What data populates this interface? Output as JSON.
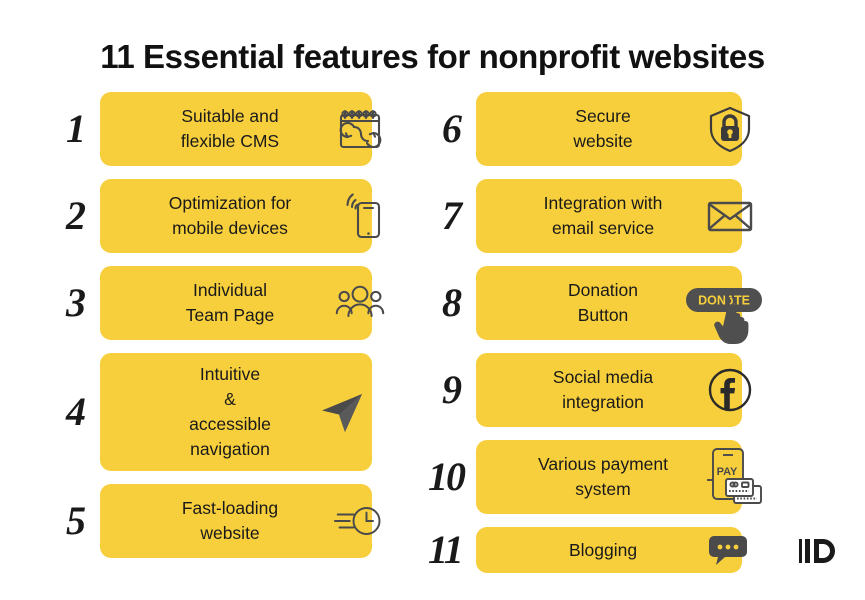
{
  "page": {
    "title": "11 Essential features for nonprofit websites",
    "background_color": "#FFFFFF",
    "accent_color": "#F7CF3C",
    "text_color": "#1A1A1A",
    "icon_color": "#4A4A4A"
  },
  "left_column": [
    {
      "number": "1",
      "label": "Suitable and\nflexible CMS",
      "icon": "cms-calendar-refresh-icon",
      "lines": 2
    },
    {
      "number": "2",
      "label": "Optimization for\nmobile devices",
      "icon": "mobile-signal-icon",
      "lines": 2
    },
    {
      "number": "3",
      "label": "Individual\nTeam Page",
      "icon": "people-group-icon",
      "lines": 2
    },
    {
      "number": "4",
      "label": "Intuitive\n&\naccessible\nnavigation",
      "icon": "navigation-arrow-icon",
      "lines": 4
    },
    {
      "number": "5",
      "label": "Fast-loading\nwebsite",
      "icon": "fast-clock-icon",
      "lines": 2
    }
  ],
  "right_column": [
    {
      "number": "6",
      "label": "Secure\nwebsite",
      "icon": "shield-lock-icon",
      "lines": 2
    },
    {
      "number": "7",
      "label": "Integration with\nemail service",
      "icon": "envelope-icon",
      "lines": 2
    },
    {
      "number": "8",
      "label": "Donation\nButton",
      "icon": "donate-button-cursor-icon",
      "icon_text": "DONATE",
      "lines": 2
    },
    {
      "number": "9",
      "label": "Social media\nintegration",
      "icon": "facebook-circle-icon",
      "lines": 2
    },
    {
      "number": "10",
      "label": "Various payment\nsystem",
      "icon": "phone-payment-cards-icon",
      "icon_text": "PAY",
      "lines": 2
    },
    {
      "number": "11",
      "label": "Blogging",
      "icon": "speech-bubble-icon",
      "lines": 1
    }
  ],
  "logo": {
    "name": "id-logo"
  }
}
